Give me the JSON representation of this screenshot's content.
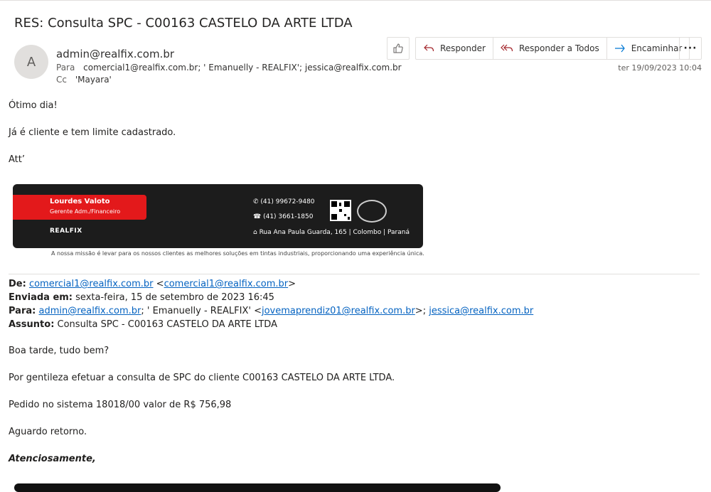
{
  "subject": "RES: Consulta SPC - C00163 CASTELO DA ARTE LTDA",
  "avatar_letter": "A",
  "sender": "admin@realfix.com.br",
  "to": {
    "label": "Para",
    "value": "comercial1@realfix.com.br; ' Emanuelly - REALFIX'; jessica@realfix.com.br"
  },
  "cc": {
    "label": "Cc",
    "value": "'Mayara'"
  },
  "actions": {
    "reply": "Responder",
    "reply_all": "Responder a Todos",
    "forward": "Encaminhar",
    "more": "···"
  },
  "date": "ter 19/09/2023 10:04",
  "body": {
    "line1": "Ótimo dia!",
    "line2": "Já é cliente e tem limite cadastrado.",
    "line3": "Att’"
  },
  "signature": {
    "name": "Lourdes Valoto",
    "role": "Gerente Adm./Financeiro",
    "logo": "REALFIX",
    "phone1": "(41) 99672-9480",
    "phone2": "(41) 3661-1850",
    "address": "Rua Ana Paula Guarda, 165 | Colombo | Paraná",
    "mission": "A nossa missão é levar para os nossos clientes as melhores soluções em tintas industriais, proporcionando uma experiência única."
  },
  "quoted": {
    "de_label": "De:",
    "de_email": "comercial1@realfix.com.br",
    "de_email2": "comercial1@realfix.com.br",
    "enviada_label": "Enviada em:",
    "enviada_value": "sexta-feira, 15 de setembro de 2023 16:45",
    "para_label": "Para:",
    "para_email1": "admin@realfix.com.br",
    "para_middle": "; ' Emanuelly - REALFIX' <",
    "para_email2": "jovemaprendiz01@realfix.com.br",
    "para_sep": ">; ",
    "para_email3": "jessica@realfix.com.br",
    "assunto_label": "Assunto:",
    "assunto_value": "Consulta SPC - C00163 CASTELO DA ARTE LTDA"
  },
  "quoted_body": {
    "line1": "Boa tarde, tudo bem?",
    "line2": "Por gentileza efetuar a consulta de SPC do cliente C00163 CASTELO DA ARTE LTDA.",
    "line3": "Pedido no sistema 18018/00 valor de R$ 756,98",
    "line4": "Aguardo retorno.",
    "closing": "Atenciosamente,"
  },
  "colors": {
    "accent": "#0563c1",
    "brand_red": "#e3191b",
    "reply_icon": "#a4262c",
    "forward_icon": "#0078d4"
  }
}
